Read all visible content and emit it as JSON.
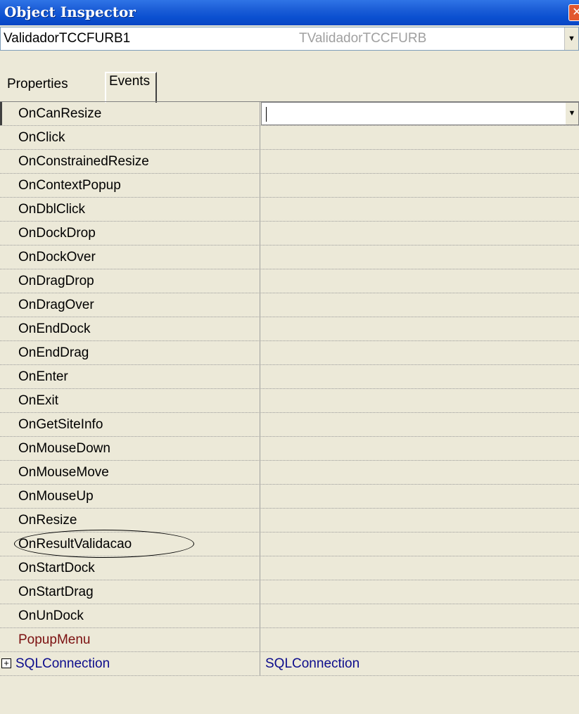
{
  "window": {
    "title": "Object Inspector",
    "close_glyph": "✕"
  },
  "selector": {
    "object_name": "ValidadorTCCFURB1",
    "object_type": "TValidadorTCCFURB",
    "dropdown_glyph": "▼"
  },
  "tabs": [
    {
      "label": "Properties"
    },
    {
      "label": "Events",
      "active": true
    }
  ],
  "events": [
    {
      "name": "OnCanResize",
      "value": ""
    },
    {
      "name": "OnClick",
      "value": ""
    },
    {
      "name": "OnConstrainedResize",
      "value": ""
    },
    {
      "name": "OnContextPopup",
      "value": ""
    },
    {
      "name": "OnDblClick",
      "value": ""
    },
    {
      "name": "OnDockDrop",
      "value": ""
    },
    {
      "name": "OnDockOver",
      "value": ""
    },
    {
      "name": "OnDragDrop",
      "value": ""
    },
    {
      "name": "OnDragOver",
      "value": ""
    },
    {
      "name": "OnEndDock",
      "value": ""
    },
    {
      "name": "OnEndDrag",
      "value": ""
    },
    {
      "name": "OnEnter",
      "value": ""
    },
    {
      "name": "OnExit",
      "value": ""
    },
    {
      "name": "OnGetSiteInfo",
      "value": ""
    },
    {
      "name": "OnMouseDown",
      "value": ""
    },
    {
      "name": "OnMouseMove",
      "value": ""
    },
    {
      "name": "OnMouseUp",
      "value": ""
    },
    {
      "name": "OnResize",
      "value": ""
    },
    {
      "name": "OnResultValidacao",
      "value": ""
    },
    {
      "name": "OnStartDock",
      "value": ""
    },
    {
      "name": "OnStartDrag",
      "value": ""
    },
    {
      "name": "OnUnDock",
      "value": ""
    },
    {
      "name": "PopupMenu",
      "value": ""
    },
    {
      "name": "SQLConnection",
      "value": "SQLConnection"
    }
  ],
  "selected_row": "OnCanResize",
  "highlighted_row": "OnResultValidacao",
  "expander_glyph": "+",
  "colors": {
    "titlebar": "#0a4fd0",
    "background": "#ece9d8",
    "reference_property": "#7b1010",
    "component_property": "#0c0c8c"
  }
}
